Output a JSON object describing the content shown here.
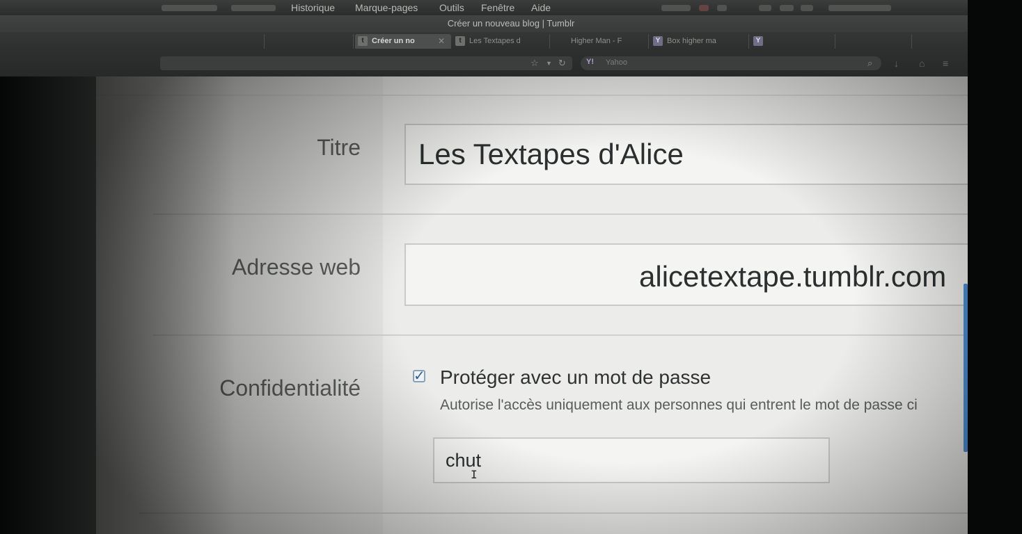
{
  "menubar": {
    "items": [
      "Historique",
      "Marque-pages",
      "Outils",
      "Fenêtre",
      "Aide"
    ]
  },
  "window": {
    "title": "Créer un nouveau blog | Tumblr"
  },
  "tabs": [
    {
      "label": "Créer un no",
      "icon": "tumblr-icon",
      "active": true
    },
    {
      "label": "Les Textapes d",
      "icon": "tumblr-icon",
      "active": false
    },
    {
      "label": "Higher Man - F",
      "icon": "",
      "active": false
    },
    {
      "label": "Box higher ma",
      "icon": "yahoo-icon",
      "active": false
    }
  ],
  "navbar": {
    "search_engine": "Y!",
    "search_placeholder": "Yahoo"
  },
  "form": {
    "title_label": "Titre",
    "title_value": "Les Textapes d'Alice",
    "web_label": "Adresse web",
    "web_value": "alicetextape.tumblr.com",
    "privacy_label": "Confidentialité",
    "password_checkbox_label": "Protéger avec un mot de passe",
    "password_checkbox_checked": true,
    "privacy_help": "Autorise l'accès uniquement aux personnes qui entrent le mot de passe ci",
    "password_value": "chut"
  },
  "colors": {
    "accent": "#2d5f93",
    "scrollbar": "#4b8fd6"
  }
}
